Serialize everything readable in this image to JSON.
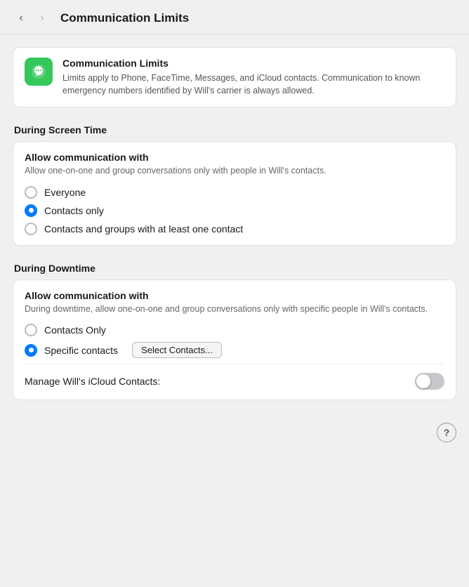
{
  "nav": {
    "title": "Communication Limits",
    "back_label": "‹",
    "forward_label": "›"
  },
  "info_card": {
    "title": "Communication Limits",
    "description": "Limits apply to Phone, FaceTime, Messages, and iCloud contacts. Communication to known emergency numbers identified by Will's carrier is always allowed.",
    "icon_label": "communication-limits-icon"
  },
  "screen_time_section": {
    "label": "During Screen Time",
    "card_title": "Allow communication with",
    "card_desc": "Allow one-on-one and group conversations only with people in Will's contacts.",
    "options": [
      {
        "label": "Everyone",
        "selected": false
      },
      {
        "label": "Contacts only",
        "selected": true
      },
      {
        "label": "Contacts and groups with at least one contact",
        "selected": false
      }
    ]
  },
  "downtime_section": {
    "label": "During Downtime",
    "card_title": "Allow communication with",
    "card_desc": "During downtime, allow one-on-one and group conversations only with specific people in Will's contacts.",
    "options": [
      {
        "label": "Contacts Only",
        "selected": false
      },
      {
        "label": "Specific contacts",
        "selected": true
      }
    ],
    "select_button_label": "Select Contacts...",
    "toggle_label": "Manage Will's iCloud Contacts:",
    "toggle_on": false
  },
  "help": {
    "label": "?"
  }
}
